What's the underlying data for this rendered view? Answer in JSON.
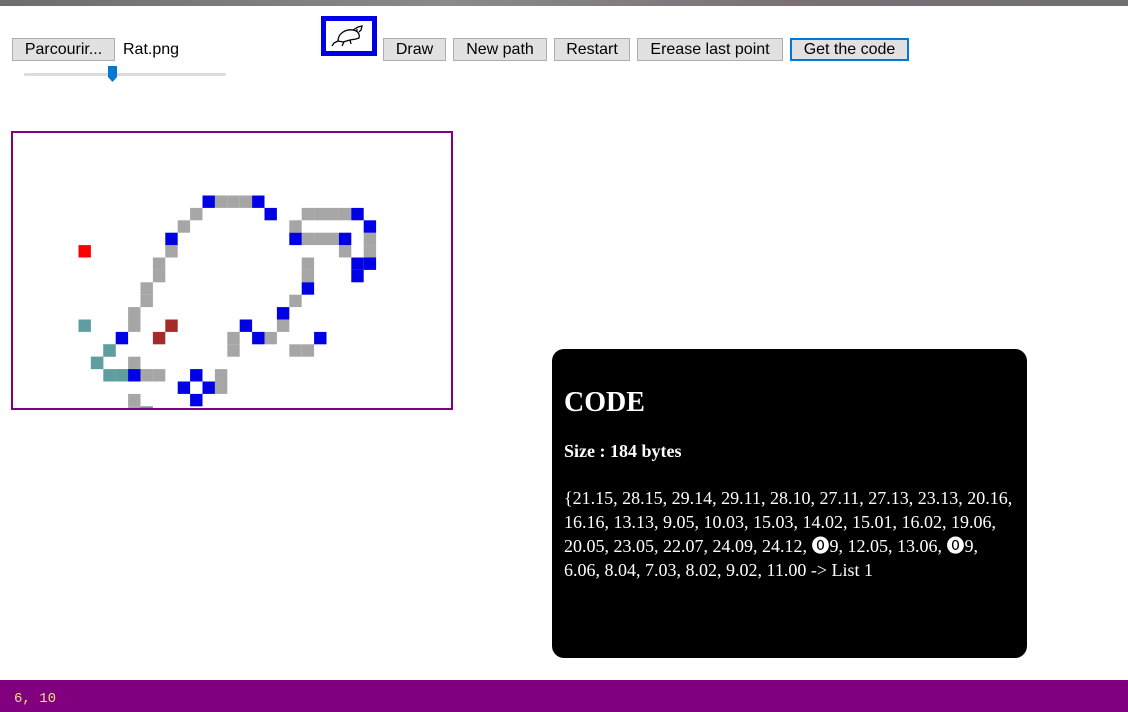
{
  "toolbar": {
    "browse_label": "Parcourir...",
    "filename": "Rat.png",
    "draw_label": "Draw",
    "new_path_label": "New path",
    "restart_label": "Restart",
    "erase_last_label": "Erease last point",
    "get_code_label": "Get the code"
  },
  "slider": {
    "value_fraction": 0.44
  },
  "preview": {
    "icon": "rat-icon"
  },
  "code_panel": {
    "title": "CODE",
    "size_text": "Size : 184 bytes",
    "code_text": "{21.15, 28.15, 29.14, 29.11, 28.10, 27.11, 27.13, 23.13, 20.16, 16.16, 13.13, 9.05, 10.03, 15.03, 14.02, 15.01, 16.02, 19.06, 20.05, 23.05, 22.07, 24.09, 24.12, ⓿9, 12.05, 13.06, ⓿9, 6.06, 8.04, 7.03, 8.02, 9.02, 11.00 -> List 1"
  },
  "status": {
    "coords": "6, 10"
  },
  "colors": {
    "canvas_border": "#800080",
    "status_bar": "#800080",
    "point_vertex": "#0000e6",
    "path_segment": "#a6a6a6",
    "secondary_path": "#5f9ea0",
    "cursor_point": "#ff0000",
    "marker_point": "#a52a2a",
    "focus_outline": "#0078d7"
  }
}
